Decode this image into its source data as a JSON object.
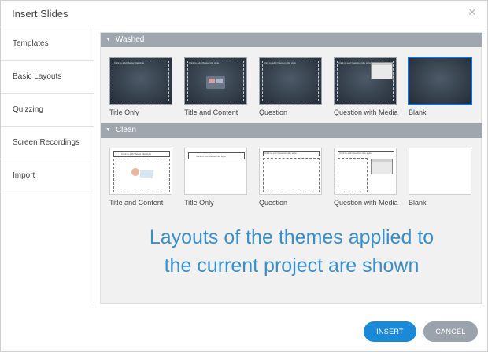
{
  "dialog": {
    "title": "Insert Slides",
    "close_icon": "close-icon"
  },
  "sidebar": {
    "items": [
      {
        "label": "Templates"
      },
      {
        "label": "Basic Layouts",
        "active": true
      },
      {
        "label": "Quizzing"
      },
      {
        "label": "Screen Recordings"
      },
      {
        "label": "Import"
      }
    ]
  },
  "sections": [
    {
      "name": "Washed",
      "layouts": [
        {
          "label": "Title Only",
          "mini_title": "Click to add Master title style"
        },
        {
          "label": "Title and Content",
          "mini_title": "Click to add Master title style"
        },
        {
          "label": "Question",
          "mini_title": "Click to add Question title style"
        },
        {
          "label": "Question with Media",
          "mini_title": "Click to add Question title style"
        },
        {
          "label": "Blank",
          "selected": true
        }
      ]
    },
    {
      "name": "Clean",
      "layouts": [
        {
          "label": "Title and Content",
          "mini_title": "Click to edit Master title style"
        },
        {
          "label": "Title Only",
          "mini_title": "Click to edit Master title style"
        },
        {
          "label": "Question",
          "mini_title": "Click to edit Question title style"
        },
        {
          "label": "Question with Media",
          "mini_title": "Click to edit Question title style"
        },
        {
          "label": "Blank"
        }
      ]
    }
  ],
  "overlay": {
    "line1": "Layouts of the themes applied to",
    "line2": "the current project are shown"
  },
  "buttons": {
    "insert": "INSERT",
    "cancel": "CANCEL"
  },
  "colors": {
    "accent": "#1a8ad8",
    "section_header": "#a0a6ad",
    "overlay_text": "#3a8fc9",
    "selected_border": "#1e6fd0"
  }
}
